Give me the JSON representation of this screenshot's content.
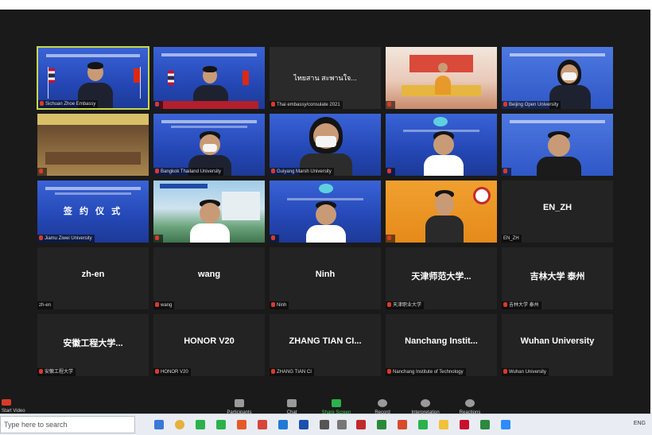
{
  "meeting": {
    "tiles": [
      {
        "label": "Sichuan Zhoe Embassy",
        "kind": "video"
      },
      {
        "label": "",
        "kind": "video"
      },
      {
        "label": "Thai embassy/consulate 2021",
        "kind": "text",
        "display": "ไทยสาน สะพานใจ..."
      },
      {
        "label": "",
        "kind": "video"
      },
      {
        "label": "Beijing Open University",
        "kind": "video"
      },
      {
        "label": "",
        "kind": "video"
      },
      {
        "label": "Bangkok Thailand University",
        "kind": "video"
      },
      {
        "label": "Guiyang Marsh University",
        "kind": "video"
      },
      {
        "label": "",
        "kind": "video"
      },
      {
        "label": "",
        "kind": "video"
      },
      {
        "label": "Jiamu Ziwei University",
        "kind": "video",
        "display": "签 约 仪 式"
      },
      {
        "label": "",
        "kind": "video"
      },
      {
        "label": "",
        "kind": "video"
      },
      {
        "label": "",
        "kind": "video"
      },
      {
        "label": "EN_ZH",
        "kind": "name",
        "display": "EN_ZH"
      },
      {
        "label": "zh-en",
        "kind": "name",
        "display": "zh-en"
      },
      {
        "label": "wang",
        "kind": "name",
        "display": "wang"
      },
      {
        "label": "Ninh",
        "kind": "name",
        "display": "Ninh"
      },
      {
        "label": "天津职业大学",
        "kind": "name",
        "display": "天津师范大学..."
      },
      {
        "label": "吉林大学 泰州",
        "kind": "name",
        "display": "吉林大学 泰州"
      },
      {
        "label": "安徽工程大学",
        "kind": "name",
        "display": "安徽工程大学..."
      },
      {
        "label": "HONOR V20",
        "kind": "name",
        "display": "HONOR V20"
      },
      {
        "label": "ZHANG TIAN CI",
        "kind": "name",
        "display": "ZHANG TIAN CI..."
      },
      {
        "label": "Nanchang Institute of Technology",
        "kind": "name",
        "display": "Nanchang Instit..."
      },
      {
        "label": "Wuhan University",
        "kind": "name",
        "display": "Wuhan University"
      }
    ]
  },
  "toolbar": {
    "video": "Start Video",
    "participants": "Participants",
    "chat": "Chat",
    "share": "Share Screen",
    "record": "Record",
    "interpretation": "Interpretation",
    "reactions": "Reactions"
  },
  "taskbar": {
    "search_text": "Type here to search",
    "tray_text": "ENG"
  }
}
